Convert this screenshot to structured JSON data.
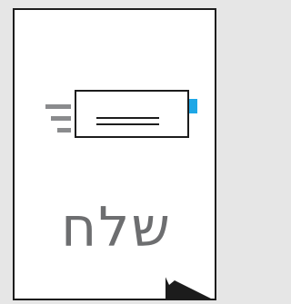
{
  "tile": {
    "label": "שלח",
    "icon": "send-mail-icon",
    "indicator": "corner-arrow-icon"
  },
  "colors": {
    "background": "#e6e6e6",
    "tile": "#ffffff",
    "border": "#1c1c1c",
    "text": "#6d6e70",
    "stamp": "#1ea7e6"
  }
}
